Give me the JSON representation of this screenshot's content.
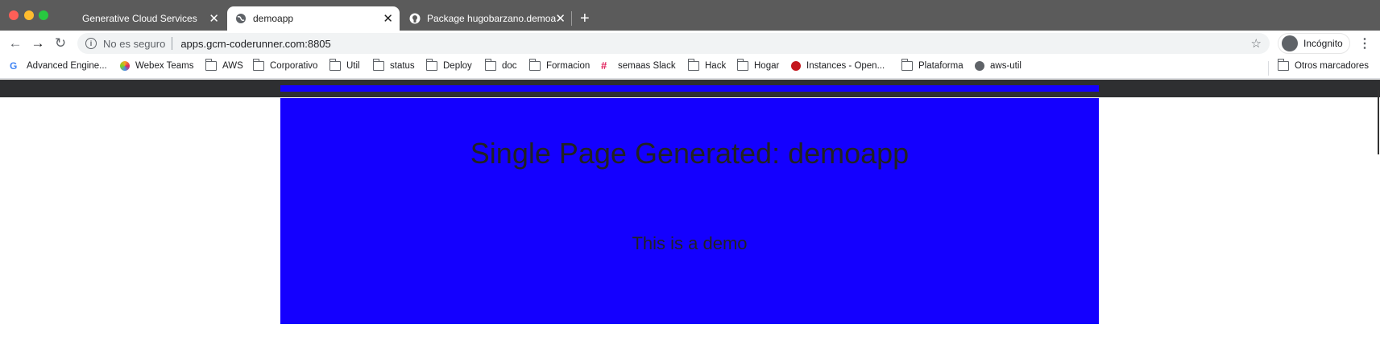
{
  "tabs": [
    {
      "title": "Generative Cloud Services",
      "active": false
    },
    {
      "title": "demoapp",
      "active": true
    },
    {
      "title": "Package hugobarzano.demoapp",
      "active": false
    }
  ],
  "toolbar": {
    "security_text": "No es seguro",
    "url": "apps.gcm-coderunner.com:8805",
    "profile_label": "Incógnito"
  },
  "bookmarks": [
    {
      "label": "Advanced Engine...",
      "icon": "google-icon"
    },
    {
      "label": "Webex Teams",
      "icon": "webex-icon"
    },
    {
      "label": "AWS",
      "icon": "folder-icon"
    },
    {
      "label": "Corporativo",
      "icon": "folder-icon"
    },
    {
      "label": "Util",
      "icon": "folder-icon"
    },
    {
      "label": "status",
      "icon": "folder-icon"
    },
    {
      "label": "Deploy",
      "icon": "folder-icon"
    },
    {
      "label": "doc",
      "icon": "folder-icon"
    },
    {
      "label": "Formacion",
      "icon": "folder-icon"
    },
    {
      "label": "semaas Slack",
      "icon": "slack-icon"
    },
    {
      "label": "Hack",
      "icon": "folder-icon"
    },
    {
      "label": "Hogar",
      "icon": "folder-icon"
    },
    {
      "label": "Instances - Open...",
      "icon": "openstack-icon"
    },
    {
      "label": "Plataforma",
      "icon": "folder-icon"
    },
    {
      "label": "aws-util",
      "icon": "globe-icon"
    }
  ],
  "other_bookmarks": "Otros marcadores",
  "page": {
    "title": "Single Page Generated: demoapp",
    "text": "This is a demo",
    "accent_color": "#1400ff"
  }
}
